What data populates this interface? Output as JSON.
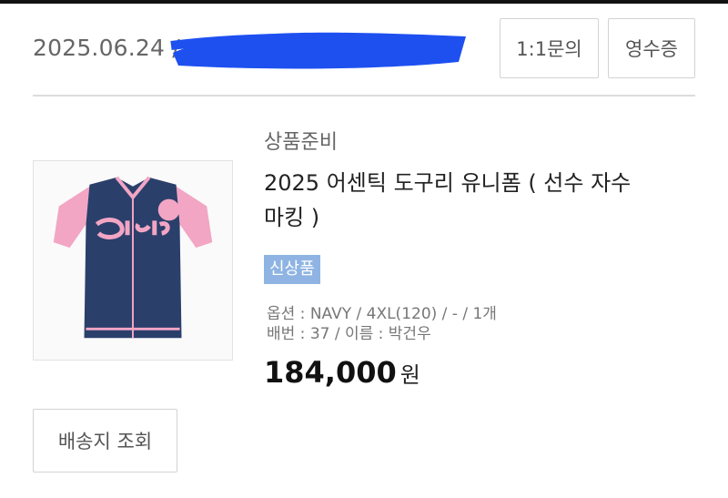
{
  "order": {
    "date_text": "2025.06.24 / 2",
    "inquiry_label": "1:1문의",
    "receipt_label": "영수증"
  },
  "product": {
    "status": "상품준비",
    "name": "2025 어센틱 도구리 유니폼 ( 선수 자수 마킹 )",
    "badge": "신상품",
    "option_line": "옵션 : NAVY / 4XL(120) / - / 1개",
    "marking_line": "배번 : 37 / 이름 : 박건우",
    "price_amount": "184,000",
    "price_unit": "원",
    "image_icon": "jersey-image"
  },
  "actions": {
    "tracking_label": "배송지 조회"
  },
  "colors": {
    "redaction": "#1e50f0",
    "badge": "#8fb4e3",
    "jersey_navy": "#2b3f6b",
    "jersey_pink": "#f2a6c4"
  }
}
